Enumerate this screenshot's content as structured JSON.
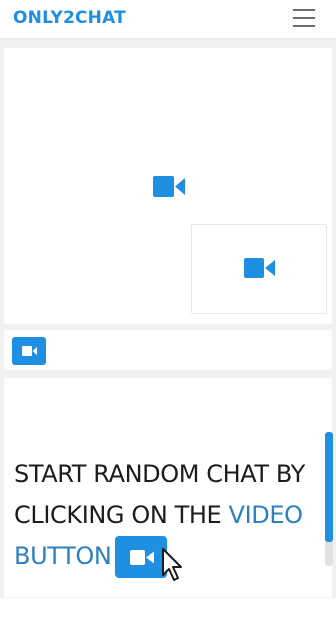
{
  "header": {
    "logo_text": "ONLY2CHAT",
    "menu_icon": "hamburger-menu-icon"
  },
  "video": {
    "remote_icon": "video-camera-icon",
    "local_icon": "video-camera-icon"
  },
  "controls": {
    "start_button_icon": "video-camera-icon"
  },
  "promo": {
    "line_plain": "START RANDOM CHAT BY CLICKING ON THE ",
    "line_accent": "VIDEO BUTTON",
    "button_icon": "video-camera-icon",
    "cursor_icon": "mouse-pointer-icon"
  },
  "colors": {
    "brand": "#1e8fe1",
    "accent_text": "#2f7fc1",
    "text": "#1c1c1c",
    "background": "#f1f1f3"
  }
}
